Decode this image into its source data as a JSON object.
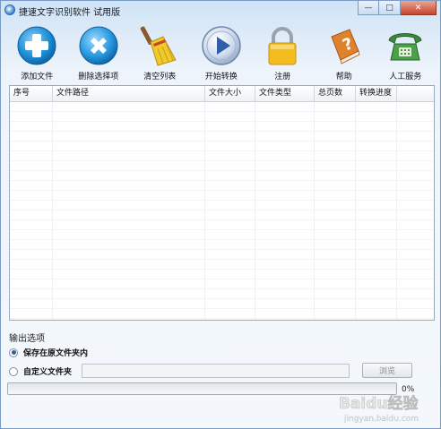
{
  "window": {
    "title": "捷速文字识别软件 试用版",
    "controls": {
      "minimize": "—",
      "maximize": "□",
      "close": "✕"
    }
  },
  "toolbar": {
    "items": [
      {
        "id": "add",
        "label": "添加文件",
        "icon": "plus-circle-icon",
        "color": "#1e90d6"
      },
      {
        "id": "remove",
        "label": "删除选择项",
        "icon": "x-circle-icon",
        "color": "#1e90d6"
      },
      {
        "id": "clear",
        "label": "清空列表",
        "icon": "broom-icon",
        "color": "#e0b418"
      },
      {
        "id": "start",
        "label": "开始转换",
        "icon": "play-circle-icon",
        "color": "#3a6fb8"
      },
      {
        "id": "register",
        "label": "注册",
        "icon": "lock-icon",
        "color": "#f0b81c"
      },
      {
        "id": "help",
        "label": "帮助",
        "icon": "help-book-icon",
        "color": "#e0822a"
      },
      {
        "id": "service",
        "label": "人工服务",
        "icon": "telephone-icon",
        "color": "#3c8a3a"
      }
    ]
  },
  "table": {
    "columns": [
      "序号",
      "文件路径",
      "文件大小",
      "文件类型",
      "总页数",
      "转换进度"
    ],
    "rows": []
  },
  "output": {
    "section_title": "输出选项",
    "option_original": "保存在原文件夹内",
    "option_custom": "自定义文件夹",
    "selected": "original",
    "custom_path_value": "",
    "browse_label": "浏览"
  },
  "progress": {
    "value": 0,
    "label": "0%"
  },
  "watermark": {
    "text": "Baidu经验",
    "sub": "jingyan.baidu.com"
  }
}
